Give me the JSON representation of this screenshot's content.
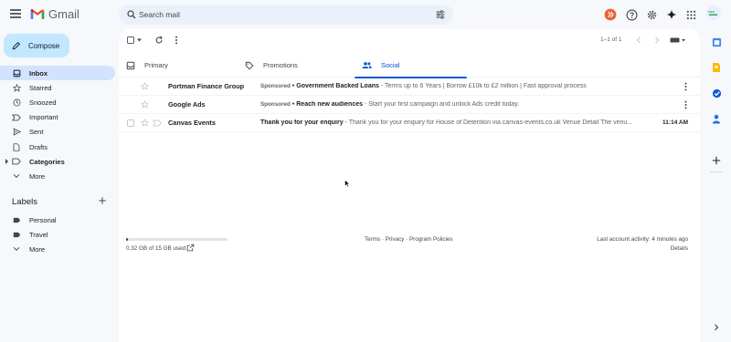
{
  "app": {
    "name": "Gmail"
  },
  "search": {
    "placeholder": "Search mail"
  },
  "compose": {
    "label": "Compose"
  },
  "sidebar": {
    "items": [
      {
        "label": "Inbox",
        "icon": "inbox-icon",
        "active": true
      },
      {
        "label": "Starred",
        "icon": "star-icon"
      },
      {
        "label": "Snoozed",
        "icon": "clock-icon"
      },
      {
        "label": "Important",
        "icon": "important-icon"
      },
      {
        "label": "Sent",
        "icon": "send-icon"
      },
      {
        "label": "Drafts",
        "icon": "draft-icon"
      },
      {
        "label": "Categories",
        "icon": "label-icon",
        "bold": true
      },
      {
        "label": "More",
        "icon": "chevron-down-icon"
      }
    ],
    "labels_title": "Labels",
    "labels": [
      {
        "label": "Personal",
        "icon": "label-icon"
      },
      {
        "label": "Travel",
        "icon": "label-icon"
      },
      {
        "label": "More",
        "icon": "chevron-down-icon"
      }
    ]
  },
  "toolbar": {
    "pager": "1–1 of 1"
  },
  "tabs": [
    {
      "label": "Primary",
      "icon": "inbox-icon"
    },
    {
      "label": "Promotions",
      "icon": "tag-icon"
    },
    {
      "label": "Social",
      "icon": "people-icon",
      "active": true
    }
  ],
  "emails": [
    {
      "sender": "Portman Finance Group",
      "sponsored": "Sponsored",
      "subject": "Government Backed Loans",
      "snippet": " - Terms up to 6 Years | Borrow £10k to £2 million | Fast approval process",
      "time": ""
    },
    {
      "sender": "Google Ads",
      "sponsored": "Sponsored",
      "subject": "Reach new audiences",
      "snippet": " - Start your first campaign and unlock Ads credit today.",
      "time": ""
    },
    {
      "sender": "Canvas Events",
      "sponsored": "",
      "subject": "Thank you for your enquiry",
      "snippet": " - Thank you for your enquiry for House of Detention via canvas-events.co.uk Venue Detail The venu...",
      "time": "11:14 AM"
    }
  ],
  "footer": {
    "storage": "0.32 GB of 15 GB used",
    "storage_fraction": 0.021,
    "links": "Terms · Privacy · Program Policies",
    "activity": "Last account activity: 4 minutes ago",
    "details": "Details"
  },
  "colors": {
    "accent": "#0b57d0",
    "compose_bg": "#c2e7ff",
    "active_nav": "#d3e3fd",
    "background": "#f6f8fc"
  }
}
